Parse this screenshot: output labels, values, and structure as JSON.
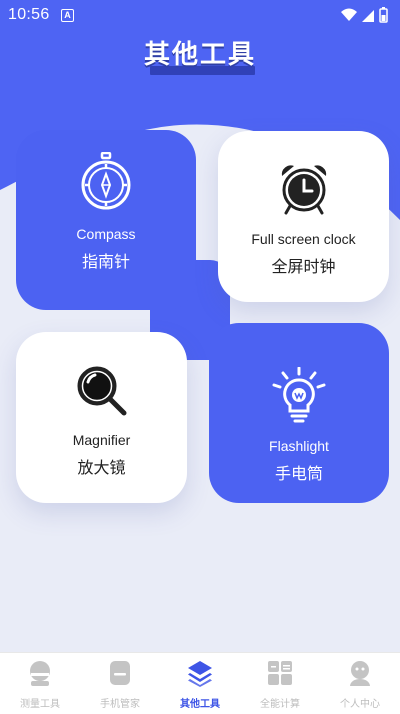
{
  "status": {
    "time": "10:56",
    "notification_letter": "A"
  },
  "header": {
    "title": "其他工具"
  },
  "tools": [
    {
      "en": "Compass",
      "cn": "指南针",
      "icon": "compass-icon"
    },
    {
      "en": "Full screen clock",
      "cn": "全屏时钟",
      "icon": "alarm-clock-icon"
    },
    {
      "en": "Magnifier",
      "cn": "放大镜",
      "icon": "magnifier-icon"
    },
    {
      "en": "Flashlight",
      "cn": "手电筒",
      "icon": "lightbulb-icon"
    }
  ],
  "nav": [
    {
      "label": "测量工具",
      "icon": "ruler-robot-icon",
      "active": false
    },
    {
      "label": "手机管家",
      "icon": "phone-manager-icon",
      "active": false
    },
    {
      "label": "其他工具",
      "icon": "layers-icon",
      "active": true
    },
    {
      "label": "全能计算",
      "icon": "calculator-icon",
      "active": false
    },
    {
      "label": "个人中心",
      "icon": "person-icon",
      "active": false
    }
  ],
  "colors": {
    "accent": "#4c62f2",
    "nav_active": "#3e55e6",
    "nav_inactive": "#bdbdbd"
  }
}
